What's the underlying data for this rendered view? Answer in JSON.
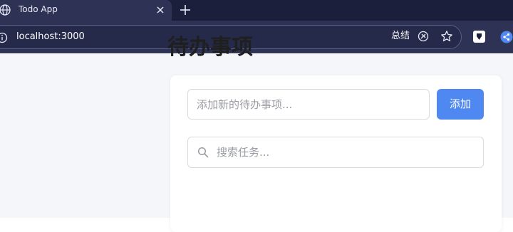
{
  "browser": {
    "tab": {
      "title": "Todo App"
    },
    "address_bar": {
      "url": "localhost:3000",
      "summary_label": "总结"
    },
    "icons": {
      "tab": "globe-icon",
      "close": "close-icon",
      "new_tab": "plus-icon",
      "site_info": "info-icon",
      "ai": "ai-sparkle-icon",
      "bookmark": "star-icon",
      "extension_1": "extension-icon",
      "extension_2": "share-icon"
    },
    "colors": {
      "tab_strip": "#1b1f3c",
      "toolbar": "#2e3356"
    }
  },
  "app": {
    "title": "待办事项",
    "new_todo": {
      "placeholder": "添加新的待办事项...",
      "value": ""
    },
    "add_button": {
      "label": "添加"
    },
    "search": {
      "placeholder": "搜索任务...",
      "value": ""
    },
    "colors": {
      "accent": "#4f88f0",
      "background": "#f4f6f9"
    }
  }
}
